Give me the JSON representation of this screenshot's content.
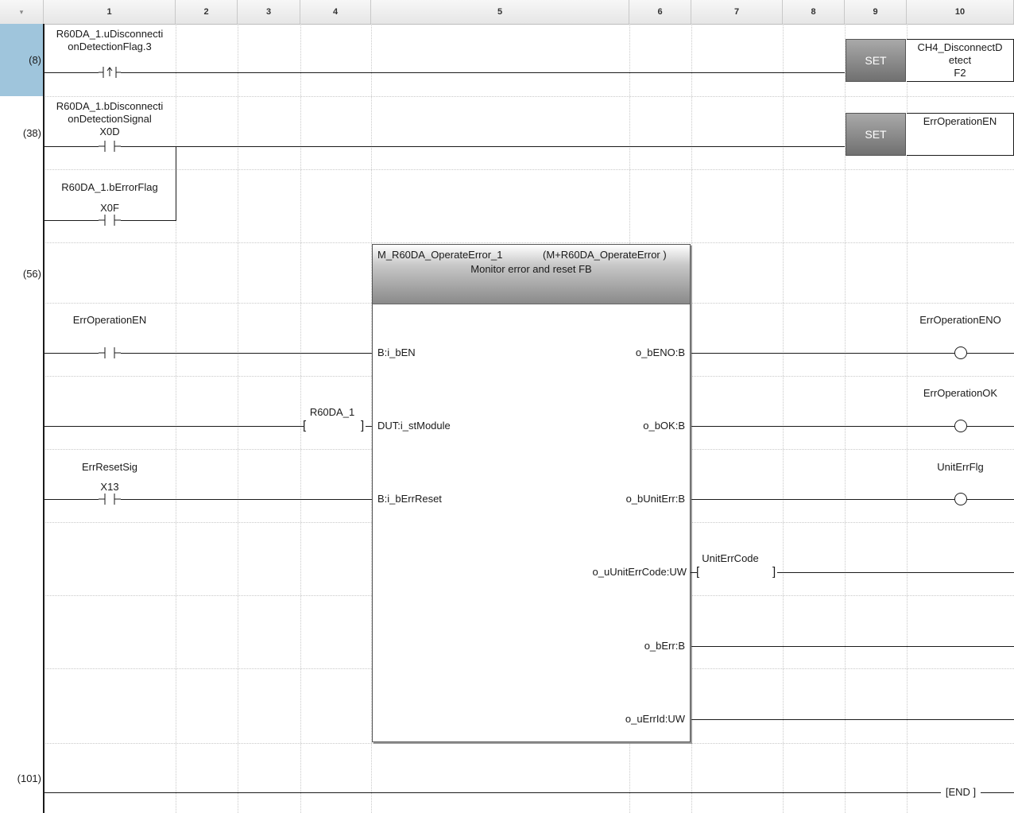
{
  "columns": [
    "1",
    "2",
    "3",
    "4",
    "5",
    "6",
    "7",
    "8",
    "9",
    "10"
  ],
  "corner_glyph": "▾",
  "rows": {
    "r8": "(8)",
    "r38": "(38)",
    "r56": "(56)",
    "r101": "(101)"
  },
  "rung8": {
    "contact_device": "R60DA_1.uDisconnectionDetectionFlag.3",
    "contact_device_line1": "R60DA_1.uDisconnecti",
    "contact_device_line2": "onDetectionFlag.3",
    "set_label": "SET",
    "target_line1": "CH4_DisconnectD",
    "target_line2": "etect",
    "target_line3": "F2"
  },
  "rung38": {
    "contact1_line1": "R60DA_1.bDisconnecti",
    "contact1_line2": "onDetectionSignal",
    "contact1_addr": "X0D",
    "contact2_label": "R60DA_1.bErrorFlag",
    "contact2_addr": "X0F",
    "set_label": "SET",
    "target": "ErrOperationEN"
  },
  "rung56": {
    "fb_instance": "M_R60DA_OperateError_1",
    "fb_type": "(M+R60DA_OperateError )",
    "fb_desc": "Monitor error and reset FB",
    "in_en_contact": "ErrOperationEN",
    "in_module_var": "R60DA_1",
    "in_reset_contact": "ErrResetSig",
    "in_reset_addr": "X13",
    "ports_in": [
      "B:i_bEN",
      "DUT:i_stModule",
      "B:i_bErrReset"
    ],
    "ports_out": [
      "o_bENO:B",
      "o_bOK:B",
      "o_bUnitErr:B",
      "o_uUnitErrCode:UW",
      "o_bErr:B",
      "o_uErrId:UW"
    ],
    "out_eno_coil": "ErrOperationENO",
    "out_ok_coil": "ErrOperationOK",
    "out_uniterr_coil": "UnitErrFlg",
    "out_code_var": "UnitErrCode"
  },
  "rung101": {
    "end_label": "END"
  }
}
